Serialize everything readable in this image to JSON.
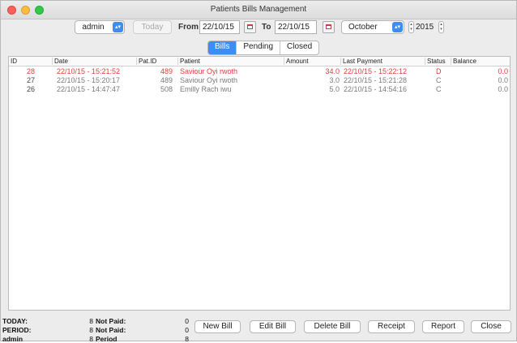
{
  "window": {
    "title": "Patients Bills Management"
  },
  "toolbar": {
    "user": "admin",
    "today": "Today",
    "from_label": "From",
    "from_date": "22/10/15",
    "to_label": "To",
    "to_date": "22/10/15",
    "month": "October",
    "year": "2015"
  },
  "tabs": [
    {
      "label": "Bills",
      "selected": true
    },
    {
      "label": "Pending",
      "selected": false
    },
    {
      "label": "Closed",
      "selected": false
    }
  ],
  "table": {
    "columns": [
      "ID",
      "Date",
      "Pat.ID",
      "Patient",
      "Amount",
      "Last Payment",
      "Status",
      "Balance"
    ],
    "rows": [
      {
        "id": "28",
        "date": "22/10/15 - 15:21:52",
        "pat_id": "489",
        "patient": "Saviour Oyi rwoth",
        "amount": "34.0",
        "last_payment": "22/10/15 - 15:22:12",
        "status": "D",
        "balance": "0.0",
        "color": "#e53b3b"
      },
      {
        "id": "27",
        "date": "22/10/15 - 15:20:17",
        "pat_id": "489",
        "patient": "Saviour Oyi rwoth",
        "amount": "3.0",
        "last_payment": "22/10/15 - 15:21:28",
        "status": "C",
        "balance": "0.0",
        "color": "#7a7a7a"
      },
      {
        "id": "26",
        "date": "22/10/15 - 14:47:47",
        "pat_id": "508",
        "patient": "Emilly Rach iwu",
        "amount": "5.0",
        "last_payment": "22/10/15 - 14:54:16",
        "status": "C",
        "balance": "0.0",
        "color": "#7a7a7a"
      }
    ]
  },
  "footer": {
    "lines": [
      {
        "label": "TODAY:",
        "count": "8",
        "np_label": "Not Paid:",
        "np_value": "0"
      },
      {
        "label": "PERIOD:",
        "count": "8",
        "np_label": "Not Paid:",
        "np_value": "0"
      },
      {
        "label": "admin",
        "count": "8",
        "np_label": "Period",
        "np_value": "8"
      }
    ],
    "buttons": [
      "New Bill",
      "Edit Bill",
      "Delete Bill",
      "Receipt",
      "Report",
      "Close"
    ]
  }
}
